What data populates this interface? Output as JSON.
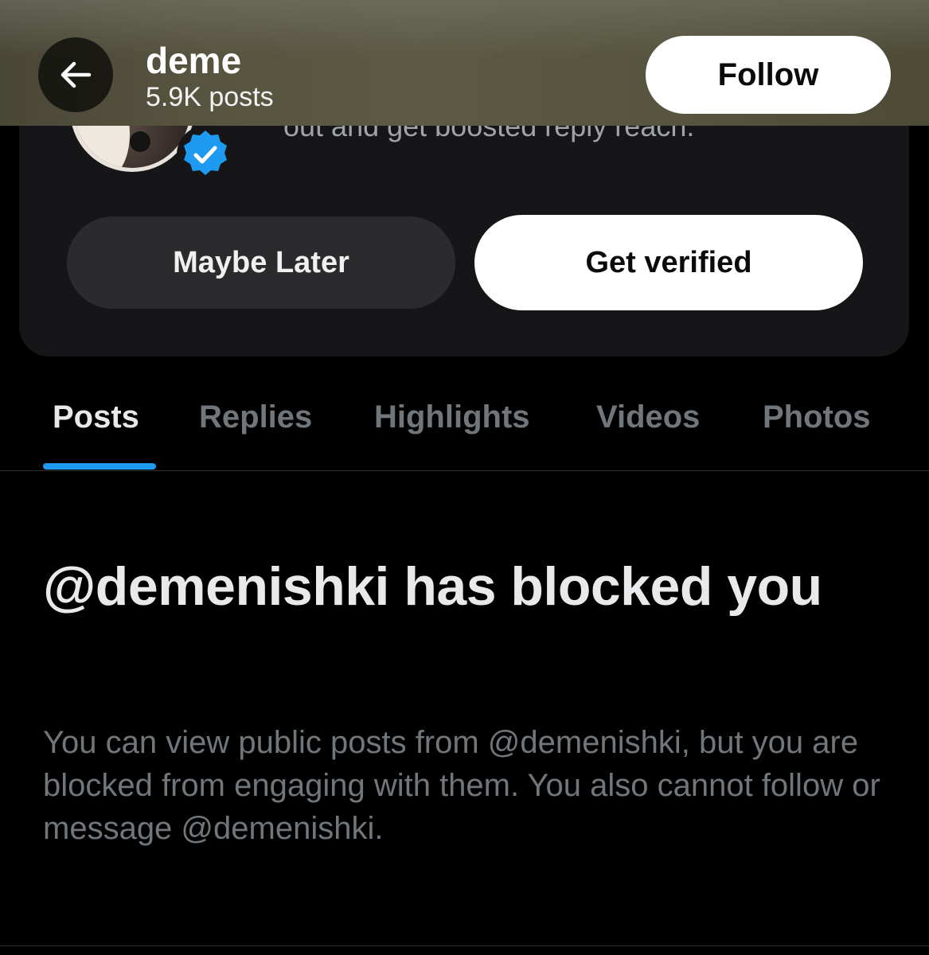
{
  "header": {
    "name": "deme",
    "posts_count": "5.9K posts",
    "follow_label": "Follow"
  },
  "promo": {
    "partial_text": "out and get boosted reply reach.",
    "maybe_later_label": "Maybe Later",
    "get_verified_label": "Get verified"
  },
  "tabs": [
    {
      "label": "Posts",
      "active": true
    },
    {
      "label": "Replies",
      "active": false
    },
    {
      "label": "Highlights",
      "active": false
    },
    {
      "label": "Videos",
      "active": false
    },
    {
      "label": "Photos",
      "active": false
    }
  ],
  "blocked": {
    "title": "@demenishki has blocked you",
    "body": "You can view public posts from @demenishki, but you are blocked from engaging with them. You also cannot follow or message @demenishki."
  },
  "colors": {
    "accent": "#1d9bf0",
    "background": "#000000",
    "muted_text": "#71767b"
  }
}
